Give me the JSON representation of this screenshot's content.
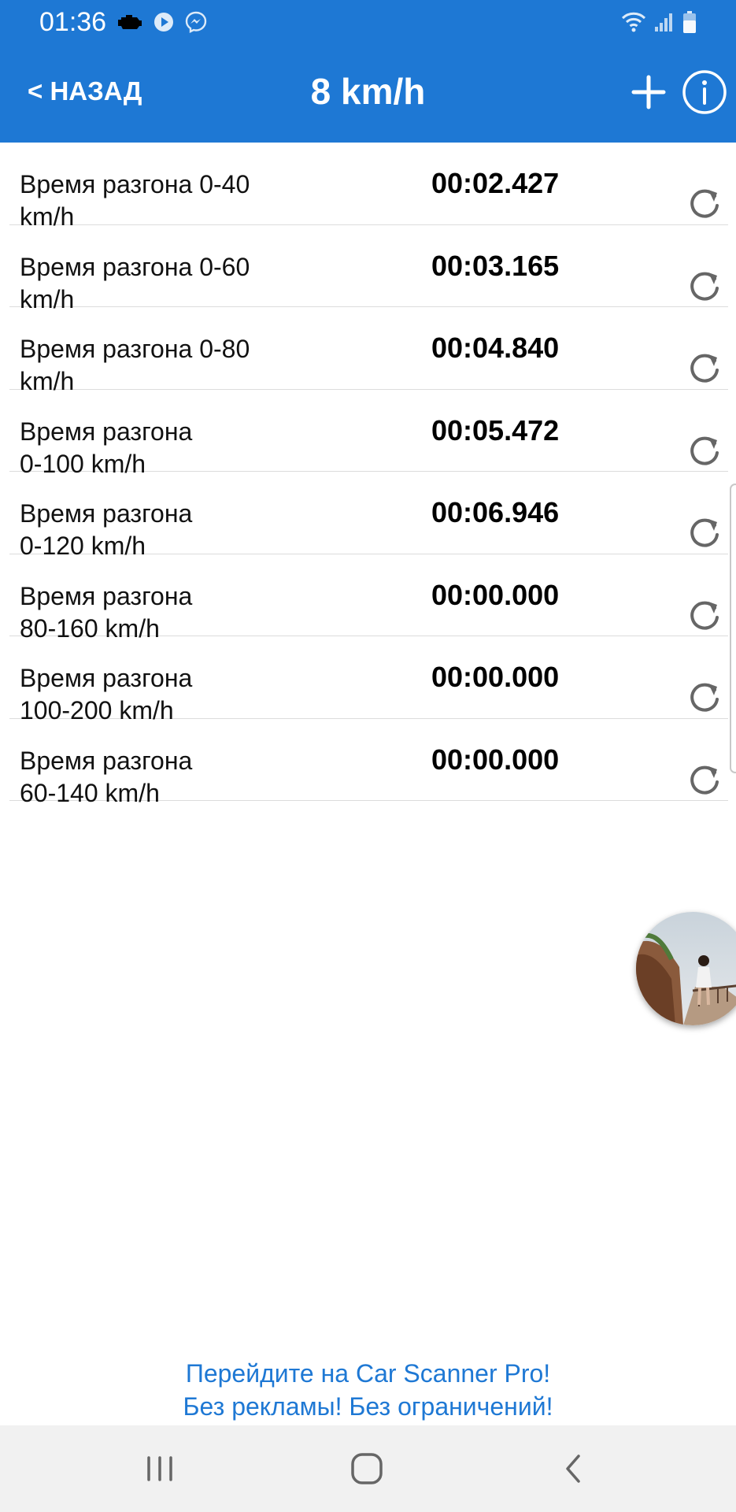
{
  "status_bar": {
    "time": "01:36",
    "left_icons": [
      "car-engine-icon",
      "play-circle-icon",
      "messenger-icon"
    ],
    "right_icons": [
      "wifi-icon",
      "signal-icon",
      "battery-icon"
    ]
  },
  "app_bar": {
    "back_label": "< НАЗАД",
    "title": "8 km/h",
    "actions": [
      "plus-icon",
      "info-icon"
    ],
    "background_color": "#1e78d4"
  },
  "results": [
    {
      "label": "Время разгона  0-40\nkm/h",
      "time": "00:02.427"
    },
    {
      "label": "Время разгона  0-60\nkm/h",
      "time": "00:03.165"
    },
    {
      "label": "Время разгона  0-80\nkm/h",
      "time": "00:04.840"
    },
    {
      "label": "Время разгона\n0-100 km/h",
      "time": "00:05.472"
    },
    {
      "label": "Время разгона\n0-120 km/h",
      "time": "00:06.946"
    },
    {
      "label": "Время разгона\n80-160 km/h",
      "time": "00:00.000"
    },
    {
      "label": "Время разгона\n100-200 km/h",
      "time": "00:00.000"
    },
    {
      "label": "Время разгона\n60-140 km/h",
      "time": "00:00.000"
    }
  ],
  "promo": {
    "line1": "Перейдите на Car Scanner Pro!",
    "line2": "Без рекламы! Без ограничений!",
    "color": "#1e78d4"
  },
  "nav_bar": {
    "buttons": [
      "recent-apps-icon",
      "home-icon",
      "back-icon"
    ]
  }
}
